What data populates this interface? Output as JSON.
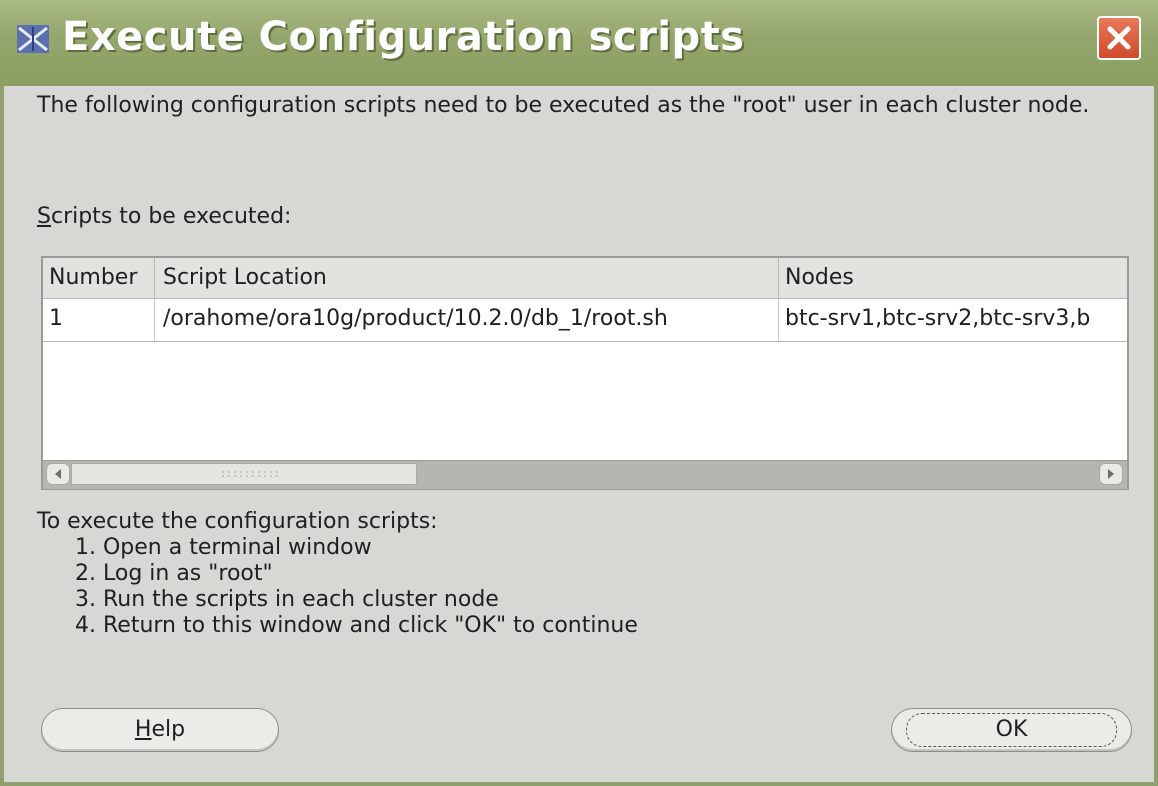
{
  "window": {
    "title": "Execute Configuration scripts",
    "app_icon": "oracle-installer-icon",
    "close_icon": "close-icon",
    "titlebar_color": "#93a66b",
    "close_color": "#d9532f"
  },
  "description": "The following configuration scripts need to be executed as the \"root\" user in each cluster node.",
  "scripts_label": {
    "mnemonic": "S",
    "rest": "cripts to be executed:"
  },
  "table": {
    "columns": [
      "Number",
      "Script Location",
      "Nodes"
    ],
    "rows": [
      [
        "1",
        "/orahome/ora10g/product/10.2.0/db_1/root.sh",
        "btc-srv1,btc-srv2,btc-srv3,b"
      ]
    ],
    "scroll_position": 0
  },
  "instructions": {
    "heading": "To execute the configuration scripts:",
    "steps": [
      "1. Open a terminal window",
      "2. Log in as \"root\"",
      "3. Run the scripts in each cluster node",
      "4. Return to this window and click \"OK\" to continue"
    ]
  },
  "buttons": {
    "help": {
      "mnemonic": "H",
      "rest": "elp"
    },
    "ok": "OK"
  }
}
